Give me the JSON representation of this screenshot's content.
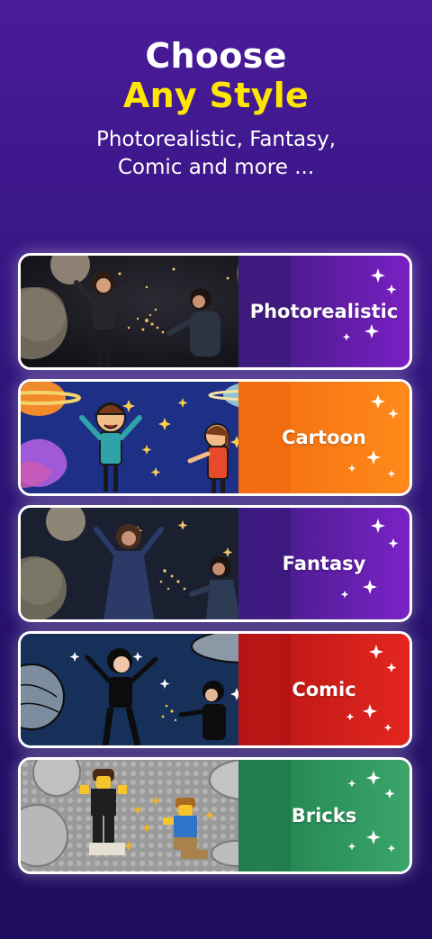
{
  "header": {
    "title_line1": "Choose",
    "title_line2": "Any Style",
    "subtitle_line1": "Photorealistic, Fantasy,",
    "subtitle_line2": "Comic and more ..."
  },
  "styles": [
    {
      "label": "Photorealistic",
      "color_from": "#3b1a7a",
      "color_to": "#7a1fc4"
    },
    {
      "label": "Cartoon",
      "color_from": "#f26b10",
      "color_to": "#ff8a1a"
    },
    {
      "label": "Fantasy",
      "color_from": "#3a1a7e",
      "color_to": "#7b22c6"
    },
    {
      "label": "Comic",
      "color_from": "#b51414",
      "color_to": "#e3261f"
    },
    {
      "label": "Bricks",
      "color_from": "#1f7d4b",
      "color_to": "#3aa66b"
    }
  ]
}
